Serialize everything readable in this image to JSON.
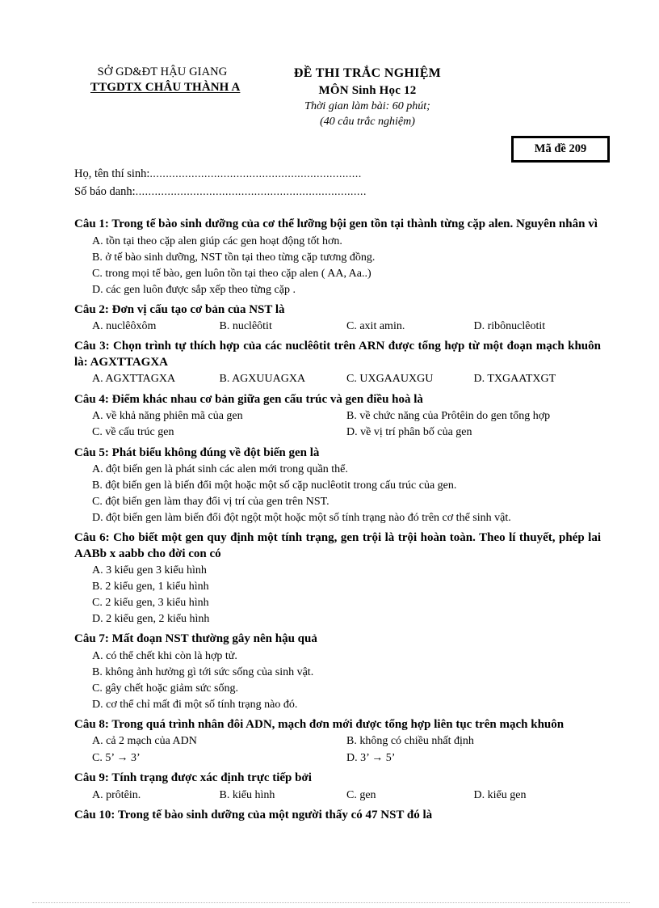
{
  "header": {
    "left_line1": "SỞ GD&ĐT HẬU GIANG",
    "left_line2": "TTGDTX CHÂU THÀNH A",
    "center_line1": "ĐỀ THI TRẮC NGHIỆM",
    "center_line2": "MÔN Sinh Học 12",
    "center_line3": "Thời gian làm bài: 60  phút;",
    "center_line4": "(40 câu trắc nghiệm)"
  },
  "exam_code": {
    "label": "Mã đề 209"
  },
  "candidate": {
    "name_label": "Họ, tên thí sinh:",
    "name_dots": "..................................................................",
    "id_label": "Số báo danh:",
    "id_dots": "........................................................................"
  },
  "questions": [
    {
      "stem": "Câu 1: Trong tế bào sinh dưỡng của cơ thể lưỡng bội gen tồn tại thành từng cặp alen. Nguyên nhân vì",
      "layout": "stacked",
      "options": [
        {
          "letter": "A.",
          "text": "tồn tại theo cặp alen giúp các gen hoạt động tốt hơn."
        },
        {
          "letter": "B.",
          "text": "ở tế bào sinh  dưỡng, NST tồn tại theo từng cặp tương đồng."
        },
        {
          "letter": "C.",
          "text": "trong mọi tế bào, gen luôn tồn tại theo cặp alen ( AA, Aa..)"
        },
        {
          "letter": "D.",
          "text": "các gen luôn được sắp xếp theo từng cặp ."
        }
      ]
    },
    {
      "stem": "Câu 2: Đơn vị cấu tạo cơ bản của NST là",
      "layout": "row4",
      "options": [
        {
          "letter": "A.",
          "text": "nuclêôxôm"
        },
        {
          "letter": "B.",
          "text": "nuclêôtit"
        },
        {
          "letter": "C.",
          "text": "axit  amin."
        },
        {
          "letter": "D.",
          "text": "ribônuclêotit"
        }
      ]
    },
    {
      "stem": "Câu 3: Chọn trình tự thích hợp của các nuclêôtit trên ARN được tổng hợp từ một đoạn mạch khuôn là: AGXTTAGXA",
      "layout": "row4",
      "options": [
        {
          "letter": "A.",
          "text": "AGXTTAGXA"
        },
        {
          "letter": "B.",
          "text": "AGXUUAGXA"
        },
        {
          "letter": "C.",
          "text": "UXGAAUXGU"
        },
        {
          "letter": "D.",
          "text": "TXGAATXGT"
        }
      ]
    },
    {
      "stem": "Câu 4: Điểm khác nhau cơ bản giữa gen cấu trúc và gen điều hoà là",
      "layout": "grid2",
      "options": [
        {
          "letter": "A.",
          "text": "về khả năng phiên mã của gen"
        },
        {
          "letter": "B.",
          "text": "về chức năng của Prôtêin do gen tổng hợp"
        },
        {
          "letter": "C.",
          "text": "về cấu trúc gen"
        },
        {
          "letter": "D.",
          "text": "về vị trí phân bố của gen"
        }
      ]
    },
    {
      "stem": "Câu 5: Phát biểu không đúng về đột biến gen là",
      "layout": "stacked",
      "options": [
        {
          "letter": "A.",
          "text": "đột biến gen là phát sinh  các alen mới trong quần thể."
        },
        {
          "letter": "B.",
          "text": "đột biến gen là biến đổi một hoặc một số cặp nuclêotit  trong cấu trúc của gen."
        },
        {
          "letter": "C.",
          "text": "đột biến gen làm thay đổi vị trí của gen trên NST."
        },
        {
          "letter": "D.",
          "text": "đột biến gen làm biến đổi đột ngột một hoặc một số tính  trạng nào đó trên cơ thể sinh  vật."
        }
      ]
    },
    {
      "stem": "Câu 6: Cho biết một gen quy định  một tính trạng, gen trội là trội hoàn toàn. Theo lí thuyết, phép lai AABb  x   aabb cho đời con có",
      "layout": "stacked",
      "options": [
        {
          "letter": "A.",
          "text": "3 kiểu gen 3 kiểu hình"
        },
        {
          "letter": "B.",
          "text": "2 kiểu gen, 1 kiểu hình"
        },
        {
          "letter": "C.",
          "text": "2 kiểu gen, 3 kiểu hình"
        },
        {
          "letter": "D.",
          "text": "2 kiểu gen, 2 kiểu hình"
        }
      ]
    },
    {
      "stem": "Câu 7: Mất đoạn NST thường gây nên hậu quả",
      "layout": "stacked",
      "options": [
        {
          "letter": "A.",
          "text": "có thể chết khi còn là hợp tử."
        },
        {
          "letter": "B.",
          "text": "không ảnh hưởng gì tới sức sống của sinh vật."
        },
        {
          "letter": "C.",
          "text": "gây chết hoặc giảm  sức sống."
        },
        {
          "letter": "D.",
          "text": "cơ thể chỉ mất đi một số tính  trạng nào đó."
        }
      ]
    },
    {
      "stem": "Câu 8: Trong quá trình nhân đôi ADN, mạch đơn mới được tổng hợp liên tục trên mạch khuôn",
      "layout": "grid2",
      "options": [
        {
          "letter": "A.",
          "text": "cả 2 mạch của ADN"
        },
        {
          "letter": "B.",
          "text": "không có chiều nhất định"
        },
        {
          "letter": "C.",
          "text": "5’  →  3’"
        },
        {
          "letter": "D.",
          "text": "3’ →  5’"
        }
      ]
    },
    {
      "stem": "Câu 9: Tính trạng được xác định trực tiếp bởi",
      "layout": "row4",
      "options": [
        {
          "letter": "A.",
          "text": "prôtêin."
        },
        {
          "letter": "B.",
          "text": "kiểu hình"
        },
        {
          "letter": "C.",
          "text": "gen"
        },
        {
          "letter": "D.",
          "text": "kiểu gen"
        }
      ]
    },
    {
      "stem": "Câu 10: Trong tế bào sinh dưỡng của một người thấy có 47 NST đó là",
      "layout": "none",
      "options": []
    }
  ]
}
